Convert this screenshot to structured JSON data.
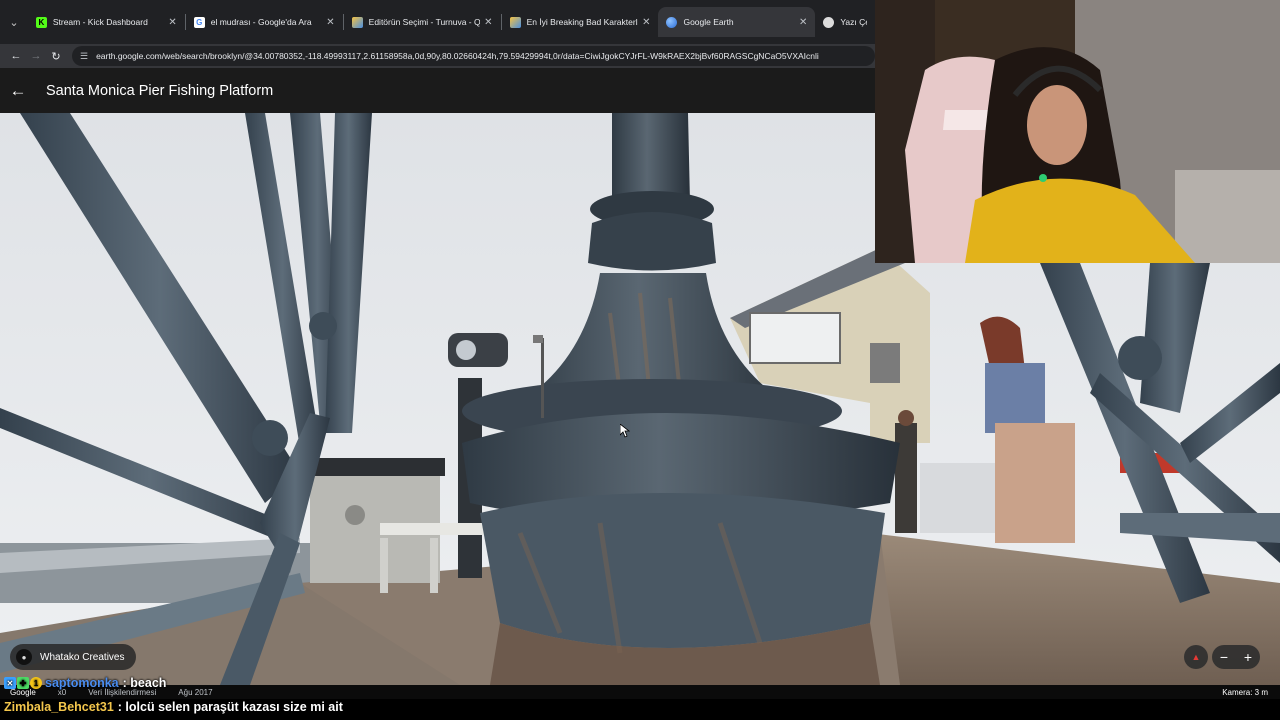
{
  "browser": {
    "tabs": [
      {
        "title": "Stream - Kick Dashboard",
        "favicon": "kick-icon",
        "color": "#53fc18",
        "active": false
      },
      {
        "title": "el mudrası - Google'da Ara",
        "favicon": "google-icon",
        "color": "#ffffff",
        "active": false
      },
      {
        "title": "Editörün Seçimi - Turnuva - Qu",
        "favicon": "rainbow-icon",
        "color": "#f6c343",
        "active": false
      },
      {
        "title": "En İyi Breaking Bad Karakterler",
        "favicon": "rainbow-icon",
        "color": "#f6c343",
        "active": false
      },
      {
        "title": "Google Earth",
        "favicon": "earth-icon",
        "color": "#4a90e2",
        "active": true
      },
      {
        "title": "Yazı Çevir",
        "favicon": "translate-icon",
        "color": "#dcdcdc",
        "active": false
      }
    ],
    "url": "earth.google.com/web/search/brooklyn/@34.00780352,-118.49993117,2.61158958a,0d,90y,80.02660424h,79.59429994t,0r/data=CiwiJgokCYJrFL-W9kRAEX2bjBvf60RAGSCgNCaO5VXAIcnli"
  },
  "earth": {
    "back_icon": "arrow-left-icon",
    "place_title": "Santa Monica Pier Fishing Platform",
    "attribution": "Whatako Creatives",
    "footer": {
      "brand": "Google",
      "item1": "x0",
      "item2": "Veri İlişkilendirmesi",
      "item3": "Ağu 2017",
      "camera": "Kamera: 3 m"
    },
    "controls": {
      "zoom_out": "−",
      "zoom_in": "+"
    }
  },
  "chat": [
    {
      "user": "saptomonka",
      "user_color": "#4a8df0",
      "message": "beach",
      "badges": [
        "#3aa0ff",
        "#4cd964",
        "#f5c518"
      ]
    },
    {
      "user": "Zimbala_Behcet31",
      "user_color": "#f3c64c",
      "message": "lolcü selen paraşüt kazası size mi ait",
      "badges": []
    }
  ]
}
